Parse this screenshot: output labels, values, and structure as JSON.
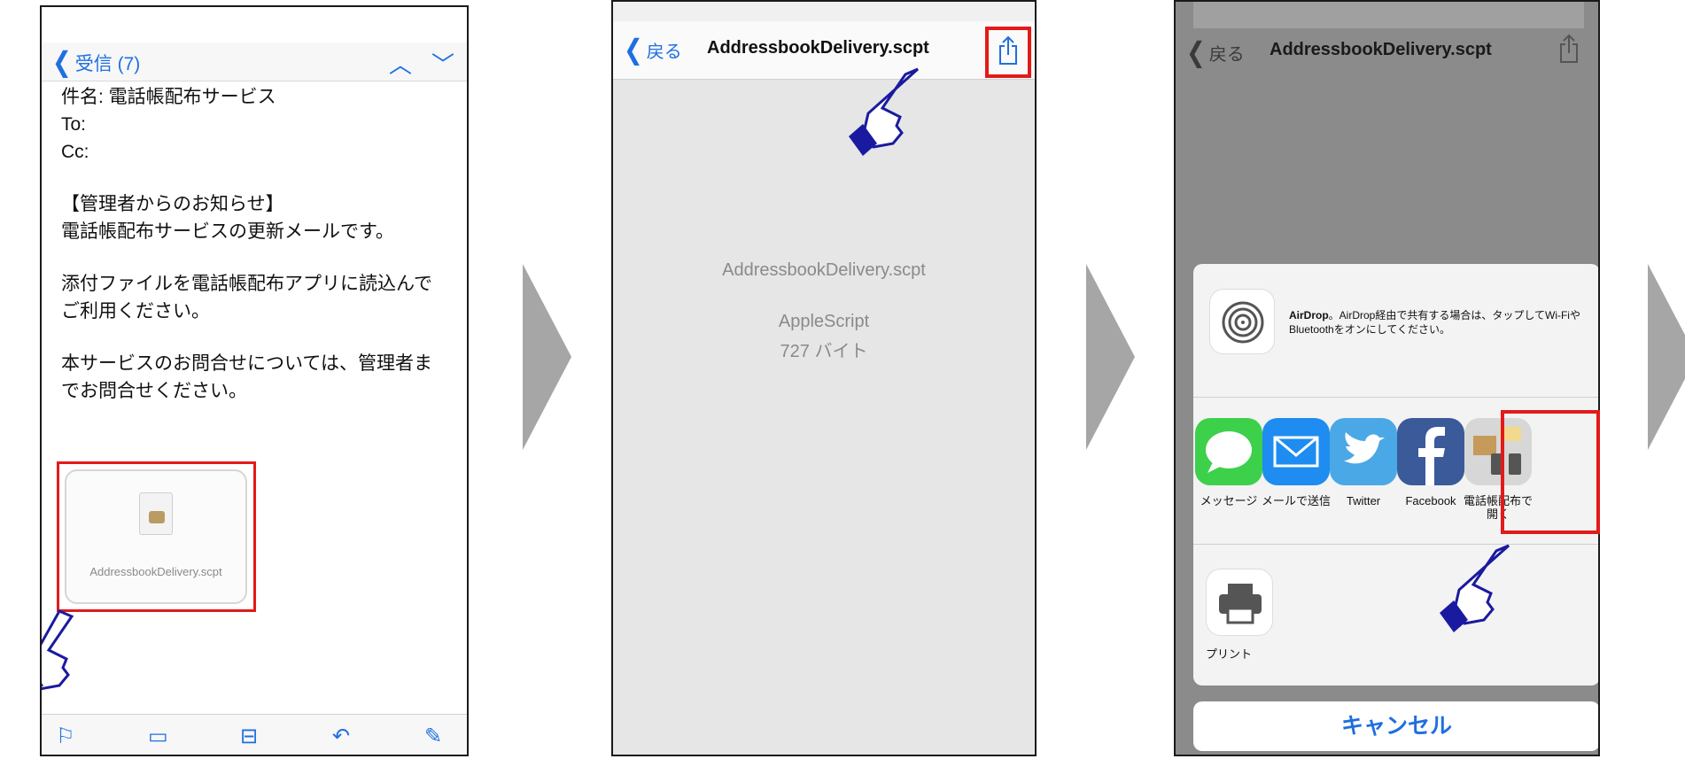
{
  "panel1": {
    "nav": {
      "back_label": "受信 (7)"
    },
    "email": {
      "subject": "件名: 電話帳配布サービス",
      "to": "To:",
      "cc": "Cc:",
      "line1": "【管理者からのお知らせ】",
      "line2": "電話帳配布サービスの更新メールです。",
      "line3": "添付ファイルを電話帳配布アプリに読込んで",
      "line4": "ご利用ください。",
      "line5": "本サービスのお問合せについては、管理者ま",
      "line6": "でお問合せください。"
    },
    "attachment": {
      "filename": "AddressbookDelivery.scpt"
    }
  },
  "panel2": {
    "nav": {
      "back_label": "戻る",
      "title": "AddressbookDelivery.scpt"
    },
    "file": {
      "name": "AddressbookDelivery.scpt",
      "kind": "AppleScript",
      "size": "727 バイト"
    }
  },
  "panel3": {
    "nav": {
      "back_label": "戻る",
      "title": "AddressbookDelivery.scpt"
    },
    "airdrop": {
      "name": "AirDrop",
      "text": "。AirDrop経由で共有する場合は、タップしてWi-FiやBluetoothをオンにしてください。"
    },
    "apps": [
      {
        "label": "メッセージ"
      },
      {
        "label": "メールで送信"
      },
      {
        "label": "Twitter"
      },
      {
        "label": "Facebook"
      },
      {
        "label": "電話帳配布で開く"
      }
    ],
    "print_label": "プリント",
    "cancel_label": "キャンセル"
  },
  "colors": {
    "accent": "#1f6fe0",
    "highlight": "#e21a1a",
    "arrow": "#a6a6a6"
  }
}
